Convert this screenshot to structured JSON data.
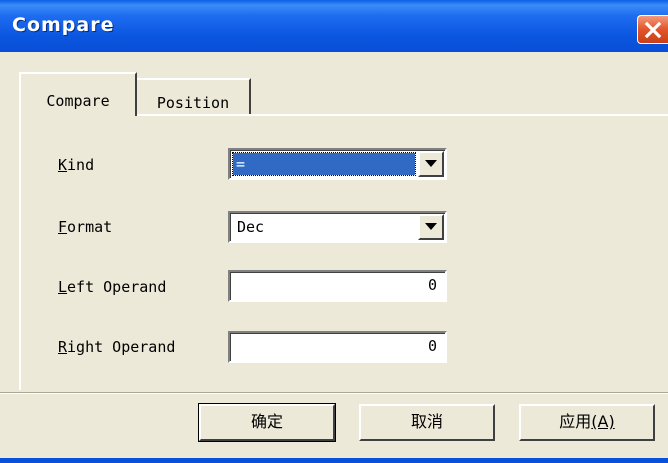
{
  "window": {
    "title": "Compare"
  },
  "tabs": [
    {
      "label": "Compare",
      "active": true
    },
    {
      "label": "Position",
      "active": false
    }
  ],
  "form": {
    "kind": {
      "label_mnemonic": "K",
      "label_rest": "ind",
      "value": "="
    },
    "format": {
      "label_mnemonic": "F",
      "label_rest": "ormat",
      "value": "Dec"
    },
    "left_operand": {
      "label_mnemonic": "L",
      "label_rest": "eft Operand",
      "value": "0"
    },
    "right_operand": {
      "label_mnemonic": "R",
      "label_rest": "ight Operand",
      "value": "0"
    }
  },
  "buttons": {
    "ok": "确定",
    "cancel": "取消",
    "apply": "应用",
    "apply_mnemonic": "(A)"
  },
  "icons": {
    "close": "close-icon",
    "dropdown": "chevron-down-icon"
  },
  "colors": {
    "titlebar": "#0A56E0",
    "close": "#E1552B",
    "selection": "#316AC5",
    "dialog": "#ECE9D8"
  }
}
